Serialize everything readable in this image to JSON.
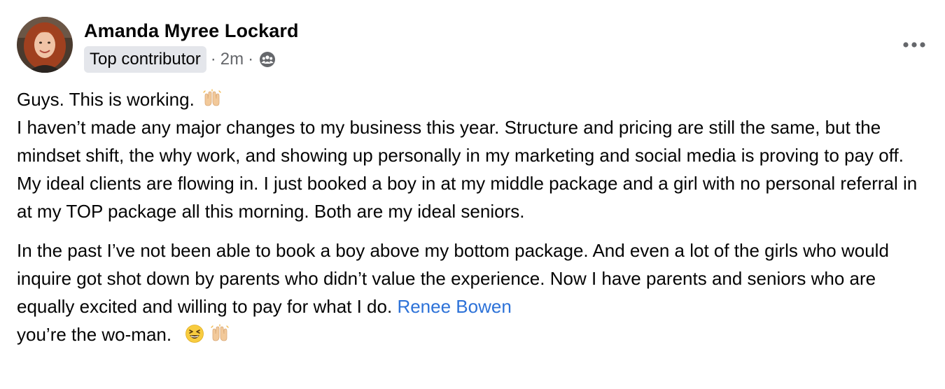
{
  "post": {
    "author": "Amanda Myree Lockard",
    "badge": "Top contributor",
    "separator": "·",
    "time": "2m",
    "audience_icon": "group-members-icon",
    "more_icon": "more-options-icon",
    "paragraphs": {
      "p1": {
        "line1": "Guys. This is working.",
        "line1_emoji": "raising-hands-icon",
        "text": "I haven’t made any major changes to my business this year. Structure and pricing are still the same, but the mindset shift, the why work, and showing up personally in my marketing and social media is proving to pay off. My ideal clients are flowing in. I just booked a boy in at my middle package and a girl with no personal referral in at my TOP package all this morning. Both are my ideal seniors."
      },
      "p2": {
        "text": "In the past I’ve not been able to book a boy above my bottom package. And even a lot of the girls who would inquire got shot down by parents who didn’t value the experience. Now I have parents and seniors who are equally excited and willing to pay for what I do.",
        "mention": "Renee Bowen",
        "tail": "you’re the wo-man.",
        "tail_emojis": [
          "grinning-squinting-face-icon",
          "raising-hands-icon"
        ]
      }
    }
  },
  "colors": {
    "text": "#050505",
    "secondary": "#65676b",
    "badge_bg": "#e4e6eb",
    "mention": "#2d72d8"
  }
}
